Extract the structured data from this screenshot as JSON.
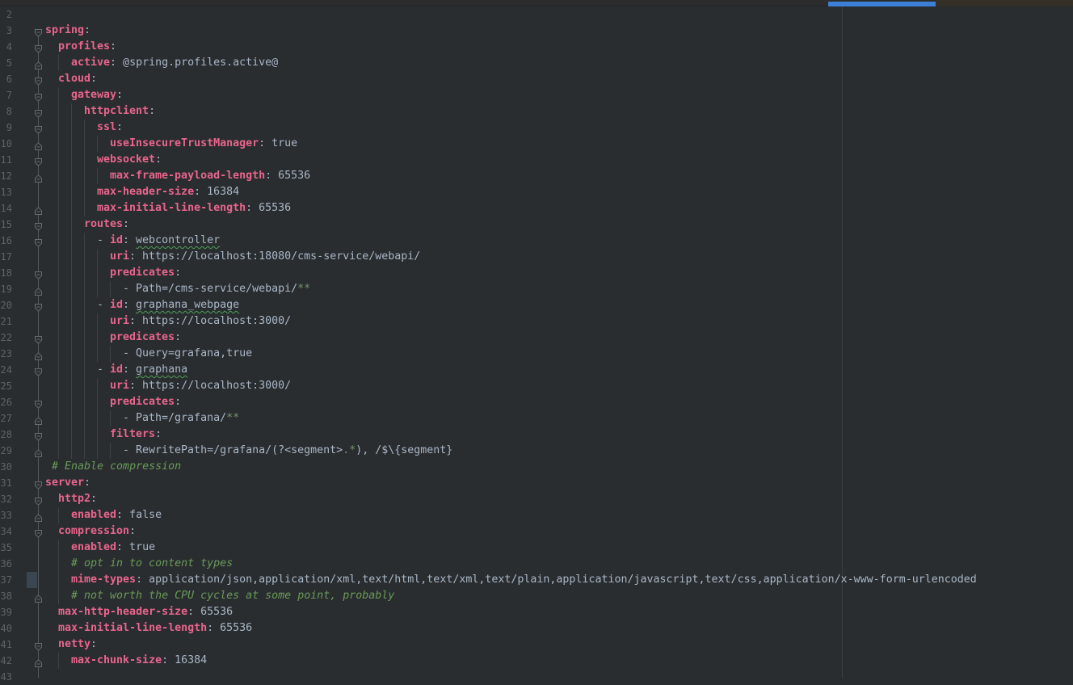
{
  "app": "yaml-editor",
  "colors": {
    "background": "#2a2d30",
    "top_strip": "#2c2c2c",
    "top_strip_right": "#343028",
    "scroll_thumb": "#3b7fd6",
    "key": "#e8658c",
    "value": "#a9b7c6",
    "comment": "#699a58",
    "dim_glob": "#78936f",
    "line_number": "#606366",
    "fold_outline": "#666a6e",
    "indent_guide": "#3c4146",
    "margin_guide": "#393d41",
    "change_marker": "#3a4750",
    "typo_underline": "#4f9f57"
  },
  "editor": {
    "lines": [
      {
        "num": 2,
        "indent": 0,
        "fold": null,
        "changed": false,
        "tokens": []
      },
      {
        "num": 3,
        "indent": 0,
        "fold": "open",
        "changed": false,
        "tokens": [
          {
            "t": "key",
            "s": "spring"
          },
          {
            "t": "text",
            "s": ":"
          }
        ]
      },
      {
        "num": 4,
        "indent": 2,
        "fold": "open",
        "changed": false,
        "tokens": [
          {
            "t": "key",
            "s": "profiles"
          },
          {
            "t": "text",
            "s": ":"
          }
        ]
      },
      {
        "num": 5,
        "indent": 4,
        "fold": "end",
        "changed": false,
        "tokens": [
          {
            "t": "key",
            "s": "active"
          },
          {
            "t": "text",
            "s": ": @spring.profiles.active@"
          }
        ]
      },
      {
        "num": 6,
        "indent": 2,
        "fold": "open",
        "changed": false,
        "tokens": [
          {
            "t": "key",
            "s": "cloud"
          },
          {
            "t": "text",
            "s": ":"
          }
        ]
      },
      {
        "num": 7,
        "indent": 4,
        "fold": "open",
        "changed": false,
        "tokens": [
          {
            "t": "key",
            "s": "gateway"
          },
          {
            "t": "text",
            "s": ":"
          }
        ]
      },
      {
        "num": 8,
        "indent": 6,
        "fold": "open",
        "changed": false,
        "tokens": [
          {
            "t": "key",
            "s": "httpclient"
          },
          {
            "t": "text",
            "s": ":"
          }
        ]
      },
      {
        "num": 9,
        "indent": 8,
        "fold": "open",
        "changed": false,
        "tokens": [
          {
            "t": "key",
            "s": "ssl"
          },
          {
            "t": "text",
            "s": ":"
          }
        ]
      },
      {
        "num": 10,
        "indent": 10,
        "fold": "end",
        "changed": false,
        "tokens": [
          {
            "t": "key",
            "s": "useInsecureTrustManager"
          },
          {
            "t": "text",
            "s": ": true"
          }
        ]
      },
      {
        "num": 11,
        "indent": 8,
        "fold": "open",
        "changed": false,
        "tokens": [
          {
            "t": "key",
            "s": "websocket"
          },
          {
            "t": "text",
            "s": ":"
          }
        ]
      },
      {
        "num": 12,
        "indent": 10,
        "fold": "end",
        "changed": false,
        "tokens": [
          {
            "t": "key",
            "s": "max-frame-payload-length"
          },
          {
            "t": "text",
            "s": ": 65536"
          }
        ]
      },
      {
        "num": 13,
        "indent": 8,
        "fold": null,
        "changed": false,
        "tokens": [
          {
            "t": "key",
            "s": "max-header-size"
          },
          {
            "t": "text",
            "s": ": 16384"
          }
        ]
      },
      {
        "num": 14,
        "indent": 8,
        "fold": "end",
        "changed": false,
        "tokens": [
          {
            "t": "key",
            "s": "max-initial-line-length"
          },
          {
            "t": "text",
            "s": ": 65536"
          }
        ]
      },
      {
        "num": 15,
        "indent": 6,
        "fold": "open",
        "changed": false,
        "tokens": [
          {
            "t": "key",
            "s": "routes"
          },
          {
            "t": "text",
            "s": ":"
          }
        ]
      },
      {
        "num": 16,
        "indent": 8,
        "fold": "open",
        "changed": false,
        "tokens": [
          {
            "t": "text",
            "s": "- "
          },
          {
            "t": "key",
            "s": "id"
          },
          {
            "t": "text",
            "s": ": "
          },
          {
            "t": "typo",
            "s": "webcontroller"
          }
        ]
      },
      {
        "num": 17,
        "indent": 10,
        "fold": null,
        "changed": false,
        "tokens": [
          {
            "t": "key",
            "s": "uri"
          },
          {
            "t": "text",
            "s": ": https://localhost:18080/cms-service/webapi/"
          }
        ]
      },
      {
        "num": 18,
        "indent": 10,
        "fold": "open",
        "changed": false,
        "tokens": [
          {
            "t": "key",
            "s": "predicates"
          },
          {
            "t": "text",
            "s": ":"
          }
        ]
      },
      {
        "num": 19,
        "indent": 12,
        "fold": "end",
        "changed": false,
        "tokens": [
          {
            "t": "text",
            "s": "- Path=/cms-service/webapi/"
          },
          {
            "t": "dim",
            "s": "**"
          }
        ]
      },
      {
        "num": 20,
        "indent": 8,
        "fold": "open",
        "changed": false,
        "tokens": [
          {
            "t": "text",
            "s": "- "
          },
          {
            "t": "key",
            "s": "id"
          },
          {
            "t": "text",
            "s": ": "
          },
          {
            "t": "typo",
            "s": "graphana_webpage"
          }
        ]
      },
      {
        "num": 21,
        "indent": 10,
        "fold": null,
        "changed": false,
        "tokens": [
          {
            "t": "key",
            "s": "uri"
          },
          {
            "t": "text",
            "s": ": https://localhost:3000/"
          }
        ]
      },
      {
        "num": 22,
        "indent": 10,
        "fold": "open",
        "changed": false,
        "tokens": [
          {
            "t": "key",
            "s": "predicates"
          },
          {
            "t": "text",
            "s": ":"
          }
        ]
      },
      {
        "num": 23,
        "indent": 12,
        "fold": "end",
        "changed": false,
        "tokens": [
          {
            "t": "text",
            "s": "- Query=grafana,true"
          }
        ]
      },
      {
        "num": 24,
        "indent": 8,
        "fold": "open",
        "changed": false,
        "tokens": [
          {
            "t": "text",
            "s": "- "
          },
          {
            "t": "key",
            "s": "id"
          },
          {
            "t": "text",
            "s": ": "
          },
          {
            "t": "typo",
            "s": "graphana"
          }
        ]
      },
      {
        "num": 25,
        "indent": 10,
        "fold": null,
        "changed": false,
        "tokens": [
          {
            "t": "key",
            "s": "uri"
          },
          {
            "t": "text",
            "s": ": https://localhost:3000/"
          }
        ]
      },
      {
        "num": 26,
        "indent": 10,
        "fold": "open",
        "changed": false,
        "tokens": [
          {
            "t": "key",
            "s": "predicates"
          },
          {
            "t": "text",
            "s": ":"
          }
        ]
      },
      {
        "num": 27,
        "indent": 12,
        "fold": "end",
        "changed": false,
        "tokens": [
          {
            "t": "text",
            "s": "- Path=/grafana/"
          },
          {
            "t": "dim",
            "s": "**"
          }
        ]
      },
      {
        "num": 28,
        "indent": 10,
        "fold": "open",
        "changed": false,
        "tokens": [
          {
            "t": "key",
            "s": "filters"
          },
          {
            "t": "text",
            "s": ":"
          }
        ]
      },
      {
        "num": 29,
        "indent": 12,
        "fold": "end",
        "changed": false,
        "tokens": [
          {
            "t": "text",
            "s": "- RewritePath=/grafana/(?<segment>"
          },
          {
            "t": "dim",
            "s": ".*"
          },
          {
            "t": "text",
            "s": "), /$\\{segment}"
          }
        ]
      },
      {
        "num": 30,
        "indent": 1,
        "fold": null,
        "changed": false,
        "tokens": [
          {
            "t": "comment",
            "s": "# Enable compression"
          }
        ]
      },
      {
        "num": 31,
        "indent": 0,
        "fold": "open",
        "changed": false,
        "tokens": [
          {
            "t": "key",
            "s": "server"
          },
          {
            "t": "text",
            "s": ":"
          }
        ]
      },
      {
        "num": 32,
        "indent": 2,
        "fold": "open",
        "changed": false,
        "tokens": [
          {
            "t": "key",
            "s": "http2"
          },
          {
            "t": "text",
            "s": ":"
          }
        ]
      },
      {
        "num": 33,
        "indent": 4,
        "fold": "end",
        "changed": false,
        "tokens": [
          {
            "t": "key",
            "s": "enabled"
          },
          {
            "t": "text",
            "s": ": false"
          }
        ]
      },
      {
        "num": 34,
        "indent": 2,
        "fold": "open",
        "changed": false,
        "tokens": [
          {
            "t": "key",
            "s": "compression"
          },
          {
            "t": "text",
            "s": ":"
          }
        ]
      },
      {
        "num": 35,
        "indent": 4,
        "fold": null,
        "changed": false,
        "tokens": [
          {
            "t": "key",
            "s": "enabled"
          },
          {
            "t": "text",
            "s": ": true"
          }
        ]
      },
      {
        "num": 36,
        "indent": 4,
        "fold": null,
        "changed": false,
        "tokens": [
          {
            "t": "comment",
            "s": "# opt in to content types"
          }
        ]
      },
      {
        "num": 37,
        "indent": 4,
        "fold": null,
        "changed": true,
        "tokens": [
          {
            "t": "key",
            "s": "mime-types"
          },
          {
            "t": "text",
            "s": ": application/json,application/xml,text/html,text/xml,text/plain,application/javascript,text/css,application/x-www-form-urlencoded"
          }
        ]
      },
      {
        "num": 38,
        "indent": 4,
        "fold": "end",
        "changed": false,
        "tokens": [
          {
            "t": "comment",
            "s": "# not worth the CPU cycles at some point, probably"
          }
        ]
      },
      {
        "num": 39,
        "indent": 2,
        "fold": null,
        "changed": false,
        "tokens": [
          {
            "t": "key",
            "s": "max-http-header-size"
          },
          {
            "t": "text",
            "s": ": 65536"
          }
        ]
      },
      {
        "num": 40,
        "indent": 2,
        "fold": null,
        "changed": false,
        "tokens": [
          {
            "t": "key",
            "s": "max-initial-line-length"
          },
          {
            "t": "text",
            "s": ": 65536"
          }
        ]
      },
      {
        "num": 41,
        "indent": 2,
        "fold": "open",
        "changed": false,
        "tokens": [
          {
            "t": "key",
            "s": "netty"
          },
          {
            "t": "text",
            "s": ":"
          }
        ]
      },
      {
        "num": 42,
        "indent": 4,
        "fold": "end",
        "changed": false,
        "tokens": [
          {
            "t": "key",
            "s": "max-chunk-size"
          },
          {
            "t": "text",
            "s": ": 16384"
          }
        ]
      },
      {
        "num": 43,
        "indent": 0,
        "fold": null,
        "changed": false,
        "tokens": []
      }
    ]
  }
}
